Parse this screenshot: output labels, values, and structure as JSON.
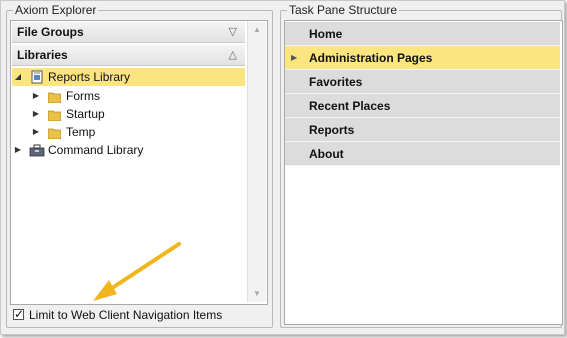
{
  "explorer": {
    "group_title": "Axiom Explorer",
    "sections": {
      "file_groups": "File Groups",
      "libraries": "Libraries"
    },
    "tree": [
      {
        "label": "Reports Library",
        "icon": "document-library-icon",
        "expanded": true,
        "selected": true
      },
      {
        "label": "Forms",
        "icon": "folder-icon"
      },
      {
        "label": "Startup",
        "icon": "folder-icon"
      },
      {
        "label": "Temp",
        "icon": "folder-icon"
      },
      {
        "label": "Command Library",
        "icon": "toolbox-icon"
      }
    ],
    "checkbox": {
      "label": "Limit to Web Client Navigation Items",
      "checked": true
    }
  },
  "task_pane": {
    "group_title": "Task Pane Structure",
    "items": [
      {
        "label": "Home"
      },
      {
        "label": "Administration Pages",
        "selected": true
      },
      {
        "label": "Favorites"
      },
      {
        "label": "Recent Places"
      },
      {
        "label": "Reports"
      },
      {
        "label": "About"
      }
    ]
  },
  "colors": {
    "selection": "#fbe57e",
    "annotation_arrow": "#f2b51c",
    "pane_row": "#dcdcdc"
  }
}
